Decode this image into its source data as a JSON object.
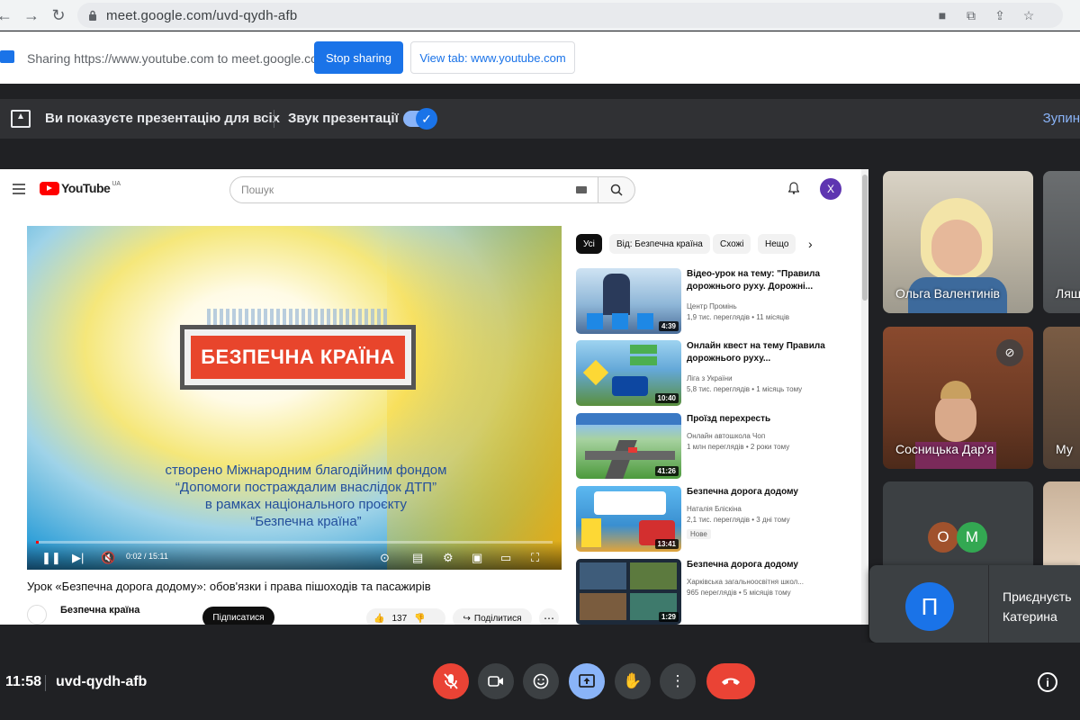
{
  "browser": {
    "url": "meet.google.com/uvd-qydh-afb",
    "back_icon": "back-arrow-icon",
    "forward_icon": "forward-arrow-icon",
    "reload_icon": "reload-icon"
  },
  "sharing_bar": {
    "text": "Sharing https://www.youtube.com to meet.google.com",
    "stop_label": "Stop sharing",
    "view_label": "View tab: www.youtube.com"
  },
  "presentation_bar": {
    "text": "Ви показуєте презентацію для всіх",
    "audio_label": "Звук презентації",
    "audio_on": true,
    "stop_label": "Зупин"
  },
  "youtube": {
    "logo_text": "YouTube",
    "logo_region": "UA",
    "search_placeholder": "Пошук",
    "avatar_letter": "X",
    "video": {
      "brand": "БЕЗПЕЧНА КРАЇНА",
      "caption": [
        "створено Міжнародним благодійним фондом",
        "“Допомоги постраждалим внаслідок ДТП”",
        "в рамках національного проєкту",
        "“Безпечна країна”"
      ],
      "time": "0:02 / 15:11",
      "progress": 0.002
    },
    "video_title": "Урок «Безпечна дорога додому»: обов'язки і права пішоходів та пасажирів",
    "channel_name": "Безпечна країна",
    "subscribe_label": "Підписатися",
    "like_count": "137",
    "share_label": "Поділитися",
    "chips": [
      "Усі",
      "Від: Безпечна країна",
      "Схожі",
      "Нещо"
    ],
    "related": [
      {
        "title": "Відео-урок на тему: \"Правила дорожнього руху. Дорожні...",
        "channel": "Центр Промінь",
        "meta": "1,9 тис. переглядів • 11 місяців",
        "duration": "4:39",
        "badge": ""
      },
      {
        "title": "Онлайн квест на тему Правила дорожнього руху...",
        "channel": "Ліга з України",
        "meta": "5,8 тис. переглядів • 1 місяць тому",
        "duration": "10:40",
        "badge": ""
      },
      {
        "title": "Проїзд перехресть",
        "channel": "Онлайн автошкола Чоп",
        "meta": "1 млн переглядів • 2 роки тому",
        "duration": "41:26",
        "badge": ""
      },
      {
        "title": "Безпечна дорога додому",
        "channel": "Наталія Бліскіна",
        "meta": "2,1 тис. переглядів • 3 дні тому",
        "duration": "13:41",
        "badge": "Нове"
      },
      {
        "title": "Безпечна дорога додому",
        "channel": "Харківська загальноосвітня школ...",
        "meta": "965 переглядів • 5 місяців тому",
        "duration": "1:29",
        "badge": ""
      }
    ]
  },
  "participants": [
    {
      "name": "Ольга Валентинів"
    },
    {
      "name": "Ляш"
    },
    {
      "name": "Сосницька Дар'я"
    },
    {
      "name": "Му"
    }
  ],
  "mini_avatars": [
    {
      "letter": "О",
      "color": "#a0522d"
    },
    {
      "letter": "М",
      "color": "#33a852"
    }
  ],
  "join_notice": {
    "avatar_letter": "П",
    "line1": "Приєднуєть",
    "line2": "Катерина"
  },
  "bottom_bar": {
    "time": "11:58",
    "meeting_code": "uvd-qydh-afb"
  },
  "colors": {
    "accent": "#1a73e8",
    "danger": "#ea4335",
    "meet_bg": "#202124"
  }
}
